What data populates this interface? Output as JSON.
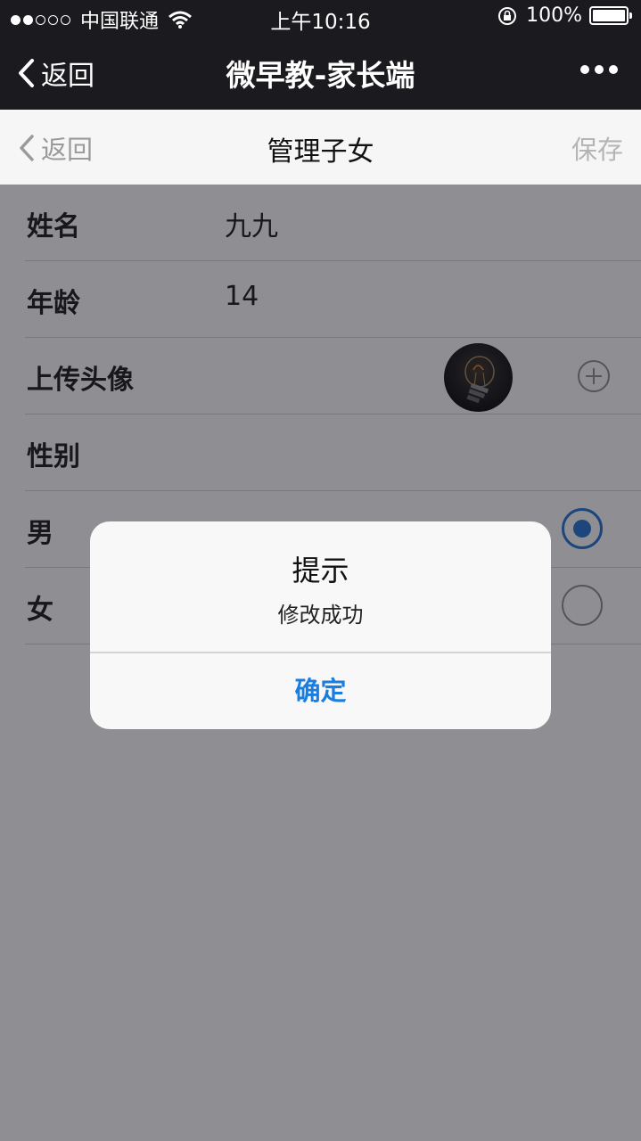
{
  "status_bar": {
    "carrier": "中国联通",
    "time": "上午10:16",
    "battery_text": "100%",
    "signal_filled": 2,
    "signal_total": 5
  },
  "wechat_header": {
    "back_label": "返回",
    "title": "微早教-家长端",
    "more_icon": "more-dots-icon"
  },
  "nav": {
    "back_label": "返回",
    "title": "管理子女",
    "save_label": "保存"
  },
  "form": {
    "name_label": "姓名",
    "name_value": "九九",
    "age_label": "年龄",
    "age_value": "14",
    "avatar_label": "上传头像",
    "gender_label": "性别",
    "male_label": "男",
    "female_label": "女",
    "selected_gender": "男"
  },
  "dialog": {
    "title": "提示",
    "message": "修改成功",
    "confirm_label": "确定"
  },
  "colors": {
    "header_bg": "#1b1b1f",
    "accent_blue": "#1a6fd0",
    "dialog_button": "#1a7ee0",
    "nav_bg": "#f6f6f6"
  }
}
